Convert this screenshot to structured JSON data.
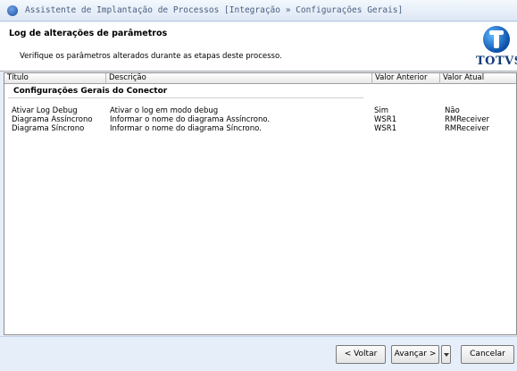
{
  "window": {
    "title": "Assistente de Implantação de Processos [Integração » Configurações Gerais]"
  },
  "header": {
    "title": "Log de alterações de parâmetros",
    "subtitle": "Verifique os parâmetros alterados durante as etapas deste processo.",
    "logo_text": "TOTVS"
  },
  "table": {
    "columns": [
      "Título",
      "Descrição",
      "Valor Anterior",
      "Valor Atual"
    ],
    "group": "Configurações Gerais do Conector",
    "rows": [
      {
        "titulo": "Ativar Log Debug",
        "descricao": "Ativar o log em modo debug",
        "anterior": "Sim",
        "atual": "Não"
      },
      {
        "titulo": "Diagrama Assíncrono",
        "descricao": "Informar o nome do diagrama Assíncrono.",
        "anterior": "WSR1",
        "atual": "RMReceiver"
      },
      {
        "titulo": "Diagrama Síncrono",
        "descricao": "Informar o nome do diagrama Síncrono.",
        "anterior": "WSR1",
        "atual": "RMReceiver"
      }
    ]
  },
  "footer": {
    "back_label": "< Voltar",
    "next_label": "Avançar >",
    "cancel_label": "Cancelar"
  }
}
